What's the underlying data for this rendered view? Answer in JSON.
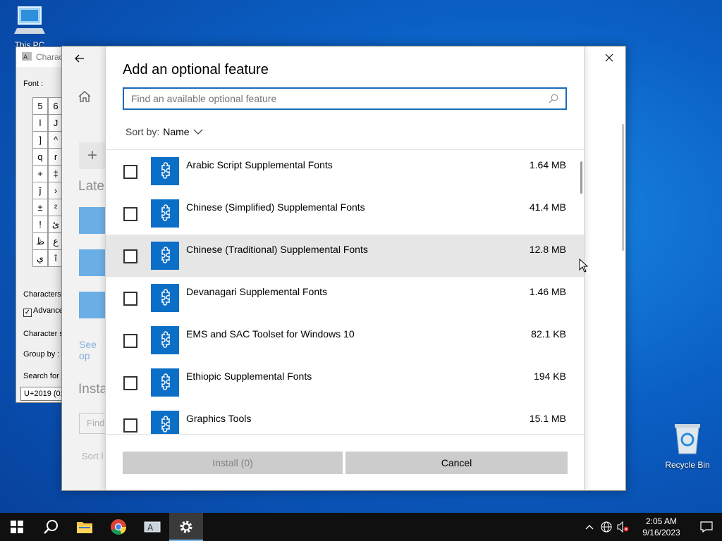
{
  "desktop": {
    "thispc_label": "This PC",
    "recycle_label": "Recycle Bin"
  },
  "charmap": {
    "title": "Charac",
    "font_label": "Font :",
    "grid": [
      "5",
      "6",
      "l",
      "J",
      "]",
      "^",
      "q",
      "r",
      "+",
      "‡",
      "ǰ",
      "›",
      "±",
      "²",
      "ǃ",
      "ئ",
      "ظ",
      "ع",
      "ي",
      "î"
    ],
    "characters_label": "Characters",
    "advanced_label": "Advance",
    "charset_label": "Character s",
    "groupby_label": "Group by :",
    "searchfor_label": "Search for",
    "code_value": "U+2019 (0x"
  },
  "settings_behind": {
    "latest_heading": "Lates",
    "see_link": "See op",
    "installed_heading": "Insta",
    "find_placeholder": "Find",
    "sort_text": "Sort l"
  },
  "dialog": {
    "title": "Add an optional feature",
    "search_placeholder": "Find an available optional feature",
    "sort_label": "Sort by:",
    "sort_value": "Name",
    "features": [
      {
        "name": "Arabic Script Supplemental Fonts",
        "size": "1.64 MB",
        "checked": false
      },
      {
        "name": "Chinese (Simplified) Supplemental Fonts",
        "size": "41.4 MB",
        "checked": false
      },
      {
        "name": "Chinese (Traditional) Supplemental Fonts",
        "size": "12.8 MB",
        "checked": false
      },
      {
        "name": "Devanagari Supplemental Fonts",
        "size": "1.46 MB",
        "checked": false
      },
      {
        "name": "EMS and SAC Toolset for Windows 10",
        "size": "82.1 KB",
        "checked": false
      },
      {
        "name": "Ethiopic Supplemental Fonts",
        "size": "194 KB",
        "checked": false
      },
      {
        "name": "Graphics Tools",
        "size": "15.1 MB",
        "checked": false
      }
    ],
    "install_label": "Install (0)",
    "cancel_label": "Cancel"
  },
  "taskbar": {
    "time": "2:05 AM",
    "date": "9/16/2023"
  },
  "colors": {
    "accent": "#0c6fc7",
    "search_border": "#1a6ab8",
    "hover_row": "#e6e6e6",
    "taskbar": "#101010"
  }
}
